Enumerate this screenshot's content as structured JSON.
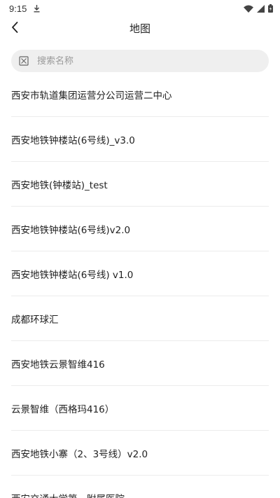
{
  "status_bar": {
    "time": "9:15",
    "icons": [
      "download-icon",
      "wifi-icon",
      "signal-icon",
      "battery-icon"
    ]
  },
  "nav": {
    "title": "地图",
    "back_icon": "chevron-left-icon"
  },
  "search": {
    "placeholder": "搜索名称",
    "value": "",
    "icon": "search-icon"
  },
  "maps": [
    {
      "label": "西安市轨道集团运营分公司运营二中心"
    },
    {
      "label": "西安地铁钟楼站(6号线)_v3.0"
    },
    {
      "label": "西安地铁(钟楼站)_test"
    },
    {
      "label": "西安地铁钟楼站(6号线)v2.0"
    },
    {
      "label": "西安地铁钟楼站(6号线) v1.0"
    },
    {
      "label": "成都环球汇"
    },
    {
      "label": "西安地铁云景智维416"
    },
    {
      "label": "云景智维（西格玛416）"
    },
    {
      "label": "西安地铁小寨（2、3号线）v2.0"
    },
    {
      "label": "西安交通大学第一附属医院"
    }
  ],
  "colors": {
    "background": "#ffffff",
    "search_background": "#efefef",
    "divider": "#ececec",
    "text": "#222222",
    "placeholder": "#9a9a9a"
  }
}
